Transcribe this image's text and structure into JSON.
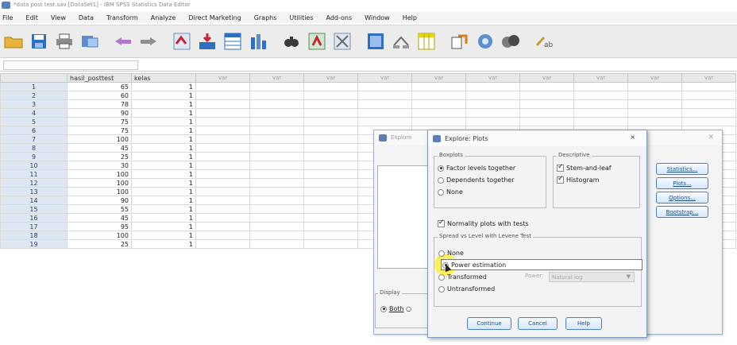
{
  "window": {
    "title": "*data post test.sav [DataSet1] - IBM SPSS Statistics Data Editor"
  },
  "menubar": {
    "items": [
      "File",
      "Edit",
      "View",
      "Data",
      "Transform",
      "Analyze",
      "Direct Marketing",
      "Graphs",
      "Utilities",
      "Add-ons",
      "Window",
      "Help"
    ]
  },
  "toolbar": {
    "icons": [
      "open-folder-icon",
      "save-icon",
      "print-icon",
      "dialog-recall-icon",
      "undo-icon",
      "redo-icon",
      "goto-case-icon",
      "goto-variable-icon",
      "variables-icon",
      "run-descriptives-icon",
      "find-icon",
      "insert-cases-icon",
      "insert-variable-icon",
      "split-file-icon",
      "weight-cases-icon",
      "select-cases-icon",
      "value-labels-icon",
      "use-sets-icon",
      "show-all-icon",
      "spelling-icon"
    ]
  },
  "grid": {
    "columns": [
      "hasil_posttest",
      "kelas",
      "var",
      "var",
      "var",
      "var",
      "var",
      "var",
      "var",
      "var",
      "var",
      "var"
    ],
    "rows": [
      {
        "n": "1",
        "hasil_posttest": "65",
        "kelas": "1"
      },
      {
        "n": "2",
        "hasil_posttest": "60",
        "kelas": "1"
      },
      {
        "n": "3",
        "hasil_posttest": "78",
        "kelas": "1"
      },
      {
        "n": "4",
        "hasil_posttest": "90",
        "kelas": "1"
      },
      {
        "n": "5",
        "hasil_posttest": "75",
        "kelas": "1"
      },
      {
        "n": "6",
        "hasil_posttest": "75",
        "kelas": "1"
      },
      {
        "n": "7",
        "hasil_posttest": "100",
        "kelas": "1"
      },
      {
        "n": "8",
        "hasil_posttest": "45",
        "kelas": "1"
      },
      {
        "n": "9",
        "hasil_posttest": "25",
        "kelas": "1"
      },
      {
        "n": "10",
        "hasil_posttest": "30",
        "kelas": "1"
      },
      {
        "n": "11",
        "hasil_posttest": "100",
        "kelas": "1"
      },
      {
        "n": "12",
        "hasil_posttest": "100",
        "kelas": "1"
      },
      {
        "n": "13",
        "hasil_posttest": "100",
        "kelas": "1"
      },
      {
        "n": "14",
        "hasil_posttest": "90",
        "kelas": "1"
      },
      {
        "n": "15",
        "hasil_posttest": "55",
        "kelas": "1"
      },
      {
        "n": "16",
        "hasil_posttest": "45",
        "kelas": "1"
      },
      {
        "n": "17",
        "hasil_posttest": "95",
        "kelas": "1"
      },
      {
        "n": "18",
        "hasil_posttest": "100",
        "kelas": "1"
      },
      {
        "n": "19",
        "hasil_posttest": "25",
        "kelas": "1"
      }
    ]
  },
  "explore_dialog": {
    "title": "Explore",
    "buttons": [
      "Statistics...",
      "Plots...",
      "Options...",
      "Bootstrap..."
    ],
    "display_label": "Display",
    "display_option": "Both"
  },
  "plots_dialog": {
    "title": "Explore: Plots",
    "close": "×",
    "boxplots": {
      "legend": "Boxplots",
      "factor_levels": "Factor levels together",
      "dependents": "Dependents together",
      "none": "None",
      "selected": "factor_levels"
    },
    "descriptive": {
      "legend": "Descriptive",
      "stem_and_leaf": "Stem-and-leaf",
      "histogram": "Histogram",
      "stem_checked": true,
      "histogram_checked": true
    },
    "normality_label": "Normality plots with tests",
    "normality_checked": true,
    "spread": {
      "legend": "Spread vs Level with Levene Test",
      "none": "None",
      "power_estimation": "Power estimation",
      "transformed": "Transformed",
      "power_label": "Power:",
      "power_value": "Natural log",
      "untransformed": "Untransformed",
      "selected": "power_estimation"
    },
    "buttons": {
      "continue": "Continue",
      "cancel": "Cancel",
      "help": "Help"
    }
  },
  "colors": {
    "accent": "#4a7fc0",
    "row_header": "#dfe7f3",
    "highlight": "#fff028"
  }
}
